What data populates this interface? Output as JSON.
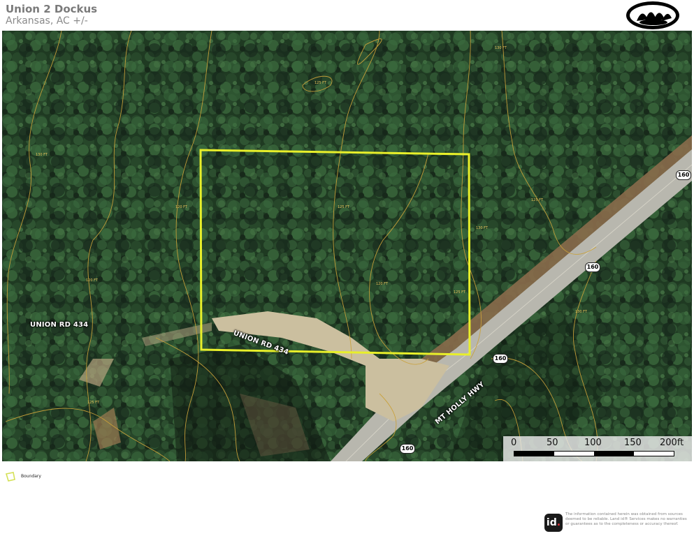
{
  "header": {
    "title": "Union 2 Dockus",
    "subtitle": "Arkansas,  AC +/-"
  },
  "map": {
    "roads": [
      {
        "label": "UNION RD 434"
      },
      {
        "label": "UNION RD 434"
      },
      {
        "label": "MT HOLLY HWY"
      }
    ],
    "shields": [
      "160",
      "160",
      "160",
      "160"
    ],
    "contours": [
      "130 FT",
      "125 FT",
      "120 FT",
      "125 FT",
      "120 FT",
      "125 FT",
      "130 FT",
      "120 FT",
      "125 FT",
      "130 FT",
      "130 FT",
      "125 FT"
    ],
    "scale": {
      "ticks": [
        "0",
        "50",
        "100",
        "150",
        "200ft"
      ]
    }
  },
  "legend": {
    "items": [
      {
        "label": "Boundary",
        "color": "#d4e157"
      }
    ]
  },
  "footer": {
    "badge_text": "id",
    "badge_dot": ".",
    "disclaimer": "The information contained herein was obtained from sources deemed to be reliable. Land id® Services makes no warranties or guarantees as to the completeness or accuracy thereof."
  },
  "colors": {
    "boundary": "#e8ef2a",
    "contour": "#c9a13a",
    "road": "#cfc9b8"
  }
}
